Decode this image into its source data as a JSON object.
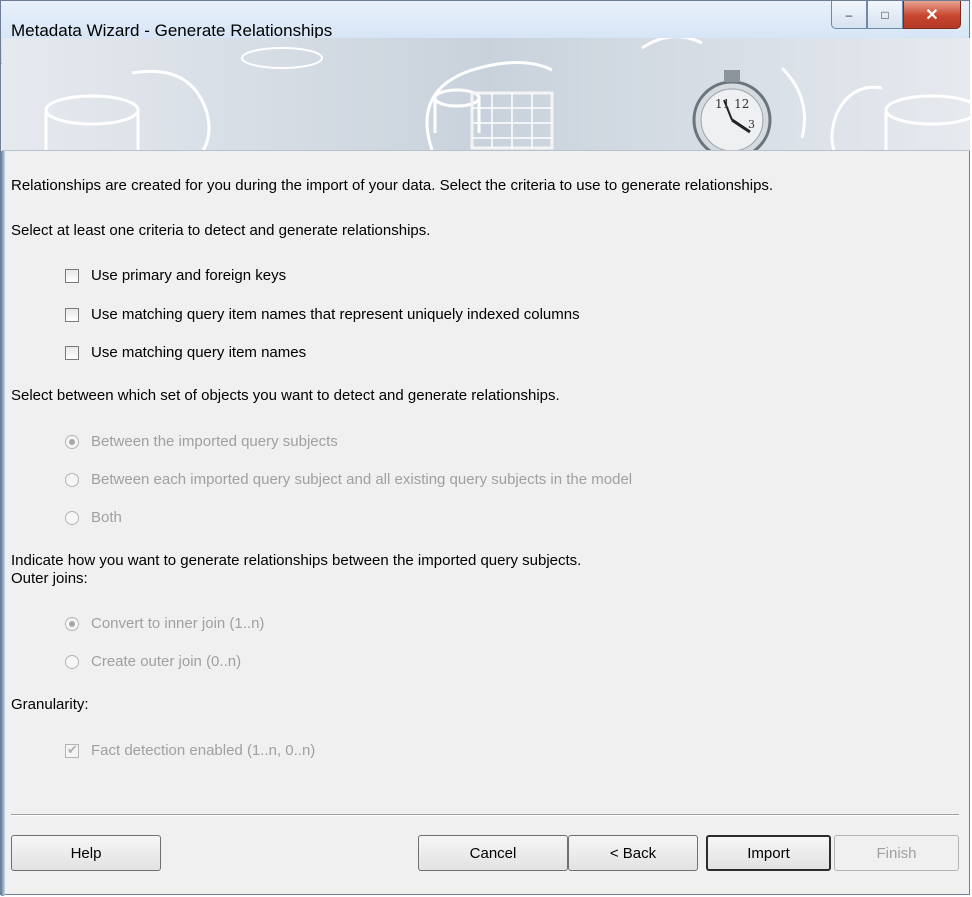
{
  "window": {
    "title": "Metadata Wizard - Generate Relationships"
  },
  "intro": "Relationships are created for you during the import of your data.  Select the criteria to use to generate relationships.",
  "criteria": {
    "prompt": "Select at least one criteria to detect and generate relationships.",
    "options": [
      {
        "label": "Use primary and foreign keys",
        "checked": false
      },
      {
        "label": "Use matching query item names that represent uniquely indexed columns",
        "checked": false
      },
      {
        "label": "Use matching query item names",
        "checked": false
      }
    ]
  },
  "objects": {
    "prompt": "Select between which set of objects you want to detect and generate relationships.",
    "options": [
      {
        "label": "Between the imported query subjects",
        "selected": true
      },
      {
        "label": "Between each imported query subject and all existing query subjects in the model",
        "selected": false
      },
      {
        "label": "Both",
        "selected": false
      }
    ]
  },
  "joins": {
    "prompt": "Indicate how you want to generate relationships between the imported query subjects.",
    "outer_label": "Outer joins:",
    "options": [
      {
        "label": "Convert to inner join (1..n)",
        "selected": true
      },
      {
        "label": "Create outer join (0..n)",
        "selected": false
      }
    ]
  },
  "granularity": {
    "label": "Granularity:",
    "fact_detection": {
      "label": "Fact detection enabled (1..n, 0..n)",
      "checked": true
    }
  },
  "buttons": {
    "help": "Help",
    "cancel": "Cancel",
    "back": "< Back",
    "import": "Import",
    "finish": "Finish"
  },
  "icons": [
    "minimize-icon",
    "maximize-icon",
    "close-icon"
  ]
}
